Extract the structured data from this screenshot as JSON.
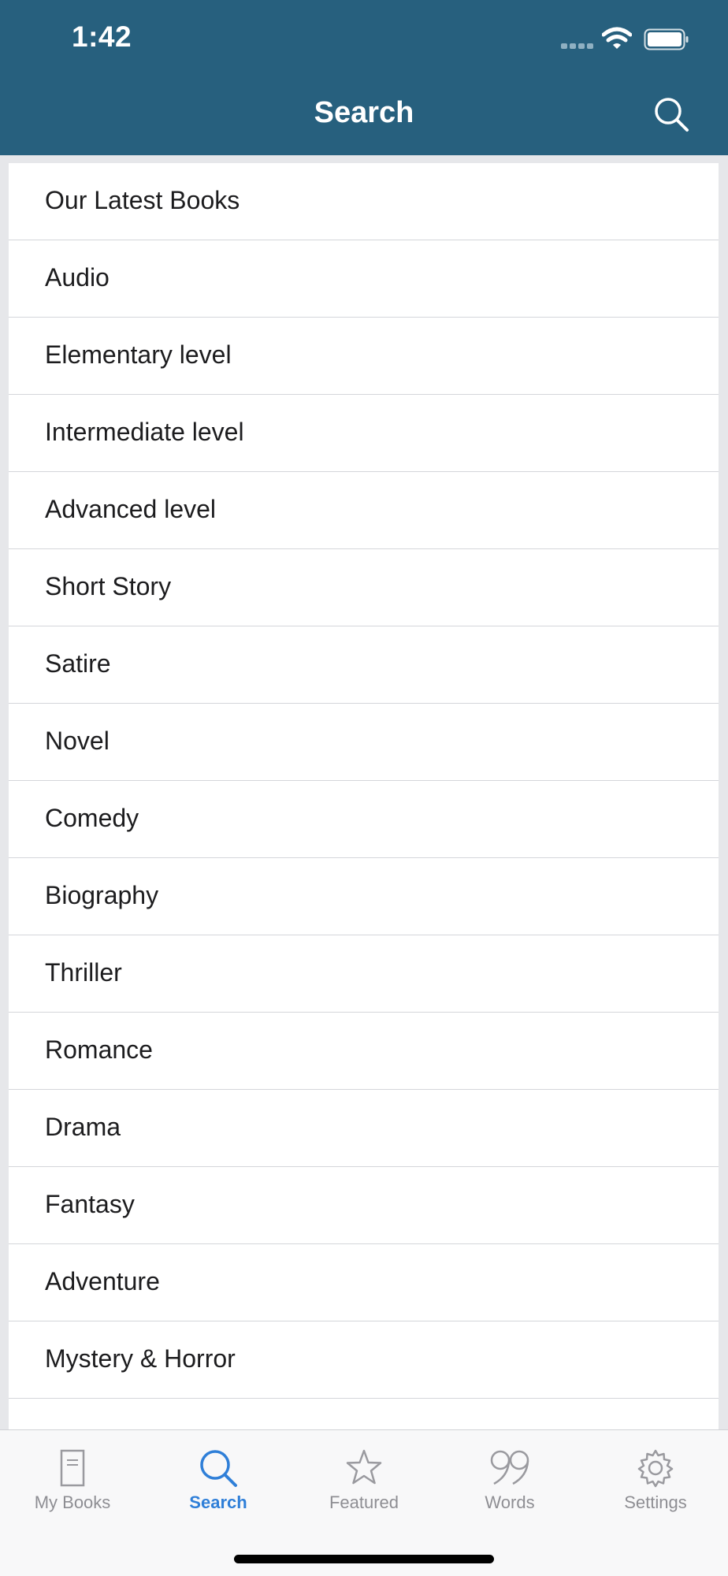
{
  "status_bar": {
    "time": "1:42"
  },
  "nav": {
    "title": "Search",
    "search_icon": "search-icon"
  },
  "categories": [
    "Our Latest Books",
    "Audio",
    "Elementary level",
    "Intermediate level",
    "Advanced level",
    "Short Story",
    "Satire",
    "Novel",
    "Comedy",
    "Biography",
    "Thriller",
    "Romance",
    "Drama",
    "Fantasy",
    "Adventure",
    "Mystery & Horror"
  ],
  "tabbar": {
    "active_tab": "Search",
    "tabs": [
      {
        "label": "My Books",
        "icon": "book-icon"
      },
      {
        "label": "Search",
        "icon": "search-icon"
      },
      {
        "label": "Featured",
        "icon": "star-icon"
      },
      {
        "label": "Words",
        "icon": "quote-icon"
      },
      {
        "label": "Settings",
        "icon": "gear-icon"
      }
    ]
  },
  "colors": {
    "header": "#27607e",
    "accent": "#2f7fd8",
    "inactive": "#8e8e93"
  }
}
